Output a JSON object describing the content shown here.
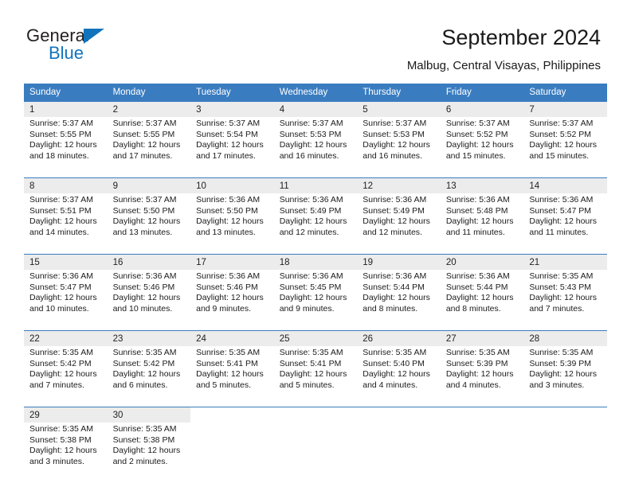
{
  "brand": {
    "name_top": "General",
    "name_bottom": "Blue",
    "triangle_color": "#1273bd"
  },
  "header": {
    "title": "September 2024",
    "subtitle": "Malbug, Central Visayas, Philippines"
  },
  "theme": {
    "header_blue": "#3a7cc0",
    "daynum_gray": "#ececec",
    "cell_white": "#ffffff"
  },
  "calendar": {
    "weekdays": [
      "Sunday",
      "Monday",
      "Tuesday",
      "Wednesday",
      "Thursday",
      "Friday",
      "Saturday"
    ],
    "weeks": [
      {
        "days": [
          {
            "num": "1",
            "sunrise": "Sunrise: 5:37 AM",
            "sunset": "Sunset: 5:55 PM",
            "daylight1": "Daylight: 12 hours",
            "daylight2": "and 18 minutes."
          },
          {
            "num": "2",
            "sunrise": "Sunrise: 5:37 AM",
            "sunset": "Sunset: 5:55 PM",
            "daylight1": "Daylight: 12 hours",
            "daylight2": "and 17 minutes."
          },
          {
            "num": "3",
            "sunrise": "Sunrise: 5:37 AM",
            "sunset": "Sunset: 5:54 PM",
            "daylight1": "Daylight: 12 hours",
            "daylight2": "and 17 minutes."
          },
          {
            "num": "4",
            "sunrise": "Sunrise: 5:37 AM",
            "sunset": "Sunset: 5:53 PM",
            "daylight1": "Daylight: 12 hours",
            "daylight2": "and 16 minutes."
          },
          {
            "num": "5",
            "sunrise": "Sunrise: 5:37 AM",
            "sunset": "Sunset: 5:53 PM",
            "daylight1": "Daylight: 12 hours",
            "daylight2": "and 16 minutes."
          },
          {
            "num": "6",
            "sunrise": "Sunrise: 5:37 AM",
            "sunset": "Sunset: 5:52 PM",
            "daylight1": "Daylight: 12 hours",
            "daylight2": "and 15 minutes."
          },
          {
            "num": "7",
            "sunrise": "Sunrise: 5:37 AM",
            "sunset": "Sunset: 5:52 PM",
            "daylight1": "Daylight: 12 hours",
            "daylight2": "and 15 minutes."
          }
        ]
      },
      {
        "days": [
          {
            "num": "8",
            "sunrise": "Sunrise: 5:37 AM",
            "sunset": "Sunset: 5:51 PM",
            "daylight1": "Daylight: 12 hours",
            "daylight2": "and 14 minutes."
          },
          {
            "num": "9",
            "sunrise": "Sunrise: 5:37 AM",
            "sunset": "Sunset: 5:50 PM",
            "daylight1": "Daylight: 12 hours",
            "daylight2": "and 13 minutes."
          },
          {
            "num": "10",
            "sunrise": "Sunrise: 5:36 AM",
            "sunset": "Sunset: 5:50 PM",
            "daylight1": "Daylight: 12 hours",
            "daylight2": "and 13 minutes."
          },
          {
            "num": "11",
            "sunrise": "Sunrise: 5:36 AM",
            "sunset": "Sunset: 5:49 PM",
            "daylight1": "Daylight: 12 hours",
            "daylight2": "and 12 minutes."
          },
          {
            "num": "12",
            "sunrise": "Sunrise: 5:36 AM",
            "sunset": "Sunset: 5:49 PM",
            "daylight1": "Daylight: 12 hours",
            "daylight2": "and 12 minutes."
          },
          {
            "num": "13",
            "sunrise": "Sunrise: 5:36 AM",
            "sunset": "Sunset: 5:48 PM",
            "daylight1": "Daylight: 12 hours",
            "daylight2": "and 11 minutes."
          },
          {
            "num": "14",
            "sunrise": "Sunrise: 5:36 AM",
            "sunset": "Sunset: 5:47 PM",
            "daylight1": "Daylight: 12 hours",
            "daylight2": "and 11 minutes."
          }
        ]
      },
      {
        "days": [
          {
            "num": "15",
            "sunrise": "Sunrise: 5:36 AM",
            "sunset": "Sunset: 5:47 PM",
            "daylight1": "Daylight: 12 hours",
            "daylight2": "and 10 minutes."
          },
          {
            "num": "16",
            "sunrise": "Sunrise: 5:36 AM",
            "sunset": "Sunset: 5:46 PM",
            "daylight1": "Daylight: 12 hours",
            "daylight2": "and 10 minutes."
          },
          {
            "num": "17",
            "sunrise": "Sunrise: 5:36 AM",
            "sunset": "Sunset: 5:46 PM",
            "daylight1": "Daylight: 12 hours",
            "daylight2": "and 9 minutes."
          },
          {
            "num": "18",
            "sunrise": "Sunrise: 5:36 AM",
            "sunset": "Sunset: 5:45 PM",
            "daylight1": "Daylight: 12 hours",
            "daylight2": "and 9 minutes."
          },
          {
            "num": "19",
            "sunrise": "Sunrise: 5:36 AM",
            "sunset": "Sunset: 5:44 PM",
            "daylight1": "Daylight: 12 hours",
            "daylight2": "and 8 minutes."
          },
          {
            "num": "20",
            "sunrise": "Sunrise: 5:36 AM",
            "sunset": "Sunset: 5:44 PM",
            "daylight1": "Daylight: 12 hours",
            "daylight2": "and 8 minutes."
          },
          {
            "num": "21",
            "sunrise": "Sunrise: 5:35 AM",
            "sunset": "Sunset: 5:43 PM",
            "daylight1": "Daylight: 12 hours",
            "daylight2": "and 7 minutes."
          }
        ]
      },
      {
        "days": [
          {
            "num": "22",
            "sunrise": "Sunrise: 5:35 AM",
            "sunset": "Sunset: 5:42 PM",
            "daylight1": "Daylight: 12 hours",
            "daylight2": "and 7 minutes."
          },
          {
            "num": "23",
            "sunrise": "Sunrise: 5:35 AM",
            "sunset": "Sunset: 5:42 PM",
            "daylight1": "Daylight: 12 hours",
            "daylight2": "and 6 minutes."
          },
          {
            "num": "24",
            "sunrise": "Sunrise: 5:35 AM",
            "sunset": "Sunset: 5:41 PM",
            "daylight1": "Daylight: 12 hours",
            "daylight2": "and 5 minutes."
          },
          {
            "num": "25",
            "sunrise": "Sunrise: 5:35 AM",
            "sunset": "Sunset: 5:41 PM",
            "daylight1": "Daylight: 12 hours",
            "daylight2": "and 5 minutes."
          },
          {
            "num": "26",
            "sunrise": "Sunrise: 5:35 AM",
            "sunset": "Sunset: 5:40 PM",
            "daylight1": "Daylight: 12 hours",
            "daylight2": "and 4 minutes."
          },
          {
            "num": "27",
            "sunrise": "Sunrise: 5:35 AM",
            "sunset": "Sunset: 5:39 PM",
            "daylight1": "Daylight: 12 hours",
            "daylight2": "and 4 minutes."
          },
          {
            "num": "28",
            "sunrise": "Sunrise: 5:35 AM",
            "sunset": "Sunset: 5:39 PM",
            "daylight1": "Daylight: 12 hours",
            "daylight2": "and 3 minutes."
          }
        ]
      },
      {
        "days": [
          {
            "num": "29",
            "sunrise": "Sunrise: 5:35 AM",
            "sunset": "Sunset: 5:38 PM",
            "daylight1": "Daylight: 12 hours",
            "daylight2": "and 3 minutes."
          },
          {
            "num": "30",
            "sunrise": "Sunrise: 5:35 AM",
            "sunset": "Sunset: 5:38 PM",
            "daylight1": "Daylight: 12 hours",
            "daylight2": "and 2 minutes."
          },
          {
            "num": "",
            "sunrise": "",
            "sunset": "",
            "daylight1": "",
            "daylight2": ""
          },
          {
            "num": "",
            "sunrise": "",
            "sunset": "",
            "daylight1": "",
            "daylight2": ""
          },
          {
            "num": "",
            "sunrise": "",
            "sunset": "",
            "daylight1": "",
            "daylight2": ""
          },
          {
            "num": "",
            "sunrise": "",
            "sunset": "",
            "daylight1": "",
            "daylight2": ""
          },
          {
            "num": "",
            "sunrise": "",
            "sunset": "",
            "daylight1": "",
            "daylight2": ""
          }
        ]
      }
    ]
  }
}
